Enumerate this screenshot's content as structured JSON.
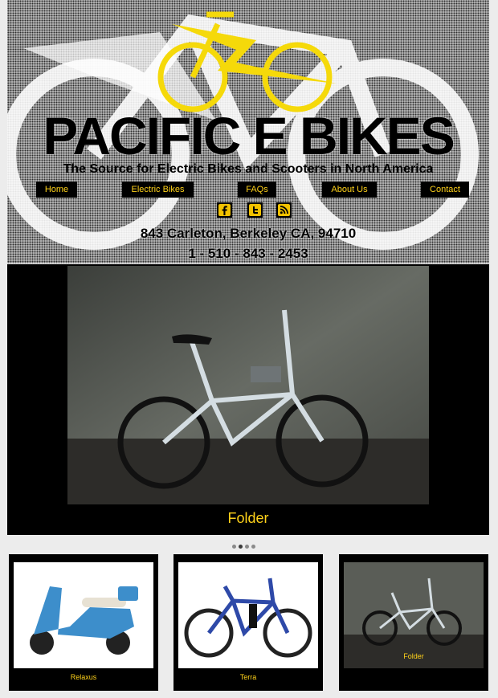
{
  "site": {
    "title": "PACIFIC E BIKES",
    "tagline": "The Source for Electric Bikes and Scooters in North America",
    "address": "843 Carleton, Berkeley CA, 94710",
    "phone": "1 - 510 - 843 - 2453"
  },
  "nav": {
    "items": [
      "Home",
      "Electric Bikes",
      "FAQs",
      "About Us",
      "Contact"
    ]
  },
  "social": {
    "icons": [
      "facebook-icon",
      "twitter-icon",
      "rss-icon"
    ]
  },
  "hero": {
    "caption": "Folder",
    "slide_count": 4,
    "active_slide": 2
  },
  "products": [
    {
      "label": "Relaxus"
    },
    {
      "label": "Terra"
    },
    {
      "label": "Folder"
    }
  ],
  "colors": {
    "accent": "#ffd21a",
    "dark": "#000000",
    "logo_yellow": "#f5d90a"
  }
}
